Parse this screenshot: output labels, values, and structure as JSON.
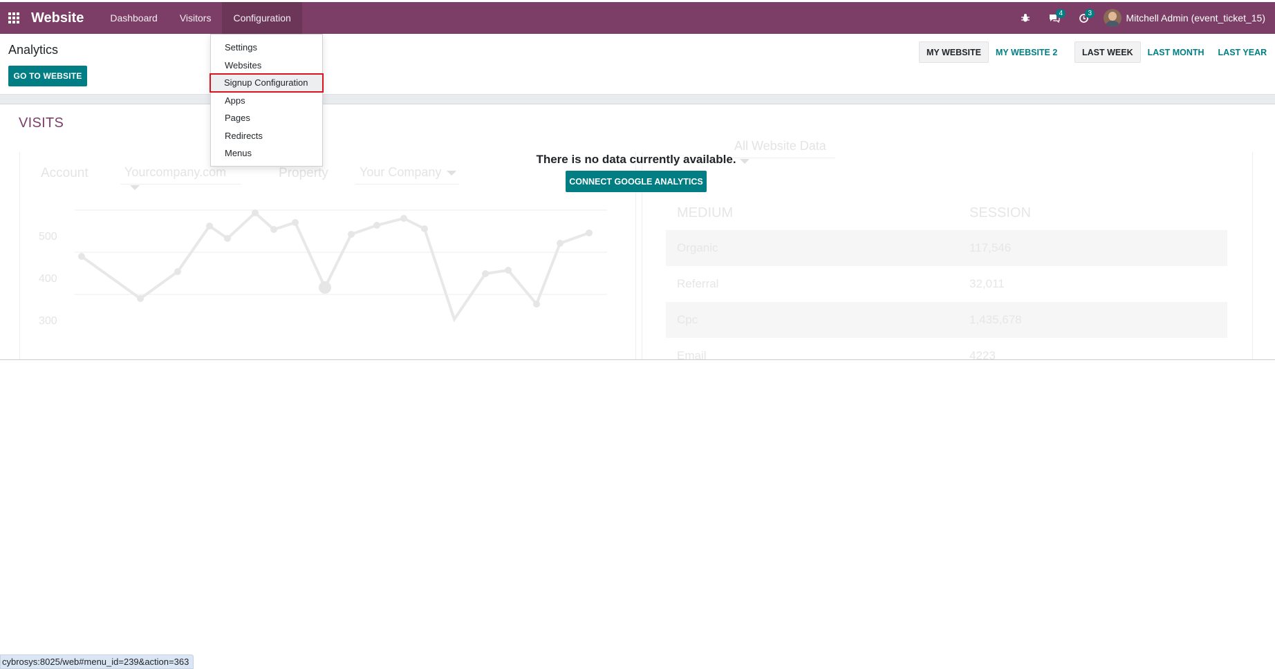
{
  "navbar": {
    "brand": "Website",
    "menu": [
      "Dashboard",
      "Visitors",
      "Configuration"
    ],
    "badges": {
      "messages": "4",
      "activities": "3"
    },
    "user": "Mitchell Admin (event_ticket_15)"
  },
  "control": {
    "title": "Analytics",
    "go_to_website": "GO TO WEBSITE",
    "websites": [
      "MY WEBSITE",
      "MY WEBSITE 2"
    ],
    "periods": [
      "LAST WEEK",
      "LAST MONTH",
      "LAST YEAR"
    ]
  },
  "dropdown": {
    "items": [
      "Settings",
      "Websites",
      "Signup Configuration",
      "Apps",
      "Pages",
      "Redirects",
      "Menus"
    ],
    "highlighted": "Signup Configuration"
  },
  "content": {
    "section_title": "VISITS",
    "no_data": "There is no data currently available.",
    "connect_button": "CONNECT GOOGLE ANALYTICS",
    "placeholder": {
      "account_label": "Account",
      "account_value": "Yourcompany.com",
      "property_label": "Property",
      "property_value": "Your Company",
      "data_filter": "All Website Data",
      "y_ticks": [
        "500",
        "400",
        "300"
      ],
      "table_headers": [
        "MEDIUM",
        "SESSION"
      ],
      "rows": [
        {
          "medium": "Organic",
          "session": "117,546"
        },
        {
          "medium": "Referral",
          "session": "32,011"
        },
        {
          "medium": "Cpc",
          "session": "1,435,678"
        },
        {
          "medium": "Email",
          "session": "4223"
        }
      ]
    }
  },
  "status_url": "cybrosys:8025/web#menu_id=239&action=363",
  "colors": {
    "navbar": "#7c3e66",
    "primary": "#017e84",
    "highlight_border": "#d9141c"
  }
}
